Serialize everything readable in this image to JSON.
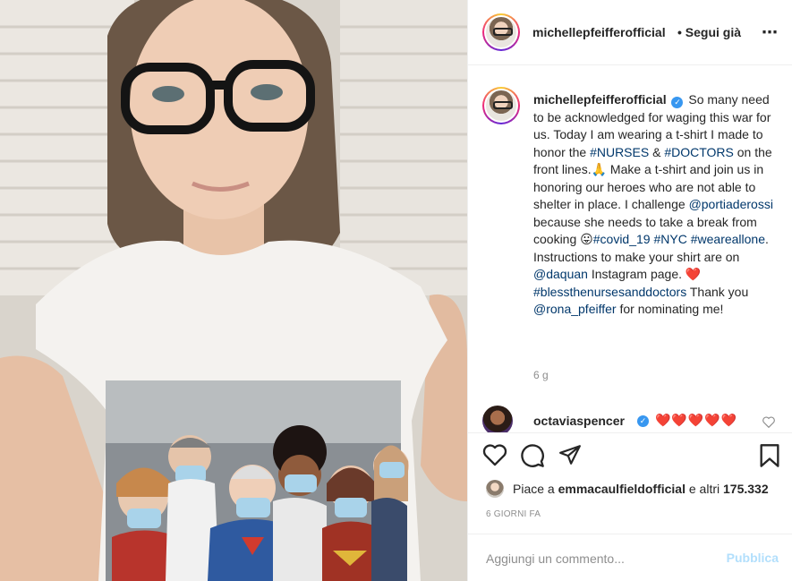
{
  "post": {
    "username": "michellepfeifferofficial",
    "follow_status": "• Segui già",
    "more_icon": "⋯",
    "caption": {
      "text_1": "So many need to be acknowledged for waging this war for us. Today I am wearing a t-shirt I made to honor the ",
      "tag_nurses": "#NURSES",
      "text_2": " & ",
      "tag_doctors": "#DOCTORS",
      "text_3": " on the front lines.🙏 Make a t-shirt and join us in honoring our heroes who are not able to shelter in place. I challenge ",
      "mention_portia": "@portiaderossi",
      "text_4": " because she needs to take a break from cooking 😛",
      "tag_covid": "#covid_19",
      "text_5": " ",
      "tag_nyc": "#NYC",
      "tag_weareallone": "#weareallone",
      "text_6": ". Instructions to make your shirt are on ",
      "mention_daquan": "@daquan",
      "text_7": " Instagram page. ❤️ ",
      "tag_bless": "#blessthenursesanddoctors",
      "text_8": " Thank you ",
      "mention_rona": "@rona_pfeiffer",
      "text_9": " for nominating me!"
    },
    "time_ago": "6 g"
  },
  "comment": {
    "username": "octaviaspencer",
    "text": "❤️❤️❤️❤️❤️"
  },
  "likes": {
    "prefix": "Piace a ",
    "user": "emmacaulfieldofficial",
    "suffix": " e altri ",
    "count": "175.332"
  },
  "date": "6 GIORNI FA",
  "add_comment": {
    "placeholder": "Aggiungi un commento...",
    "publish": "Pubblica"
  },
  "icons": {
    "like": "heart-icon",
    "comment": "comment-icon",
    "share": "share-icon",
    "save": "bookmark-icon"
  },
  "colors": {
    "link": "#00376b",
    "verified": "#3897f0",
    "publish_disabled": "#b2dffc",
    "heart": "#ed4956"
  }
}
